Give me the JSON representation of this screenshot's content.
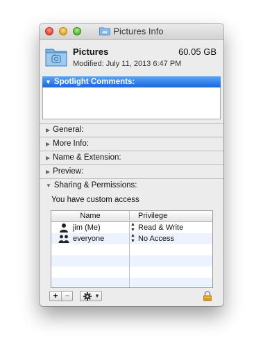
{
  "window": {
    "title": "Pictures Info"
  },
  "header": {
    "name": "Pictures",
    "size": "60.05 GB",
    "modified": "Modified: July 11, 2013 6:47 PM"
  },
  "spotlight": {
    "label": "Spotlight Comments:",
    "value": ""
  },
  "sections": {
    "general": "General:",
    "more_info": "More Info:",
    "name_extension": "Name & Extension:",
    "preview": "Preview:",
    "sharing": "Sharing & Permissions:"
  },
  "permissions": {
    "note": "You have custom access",
    "columns": {
      "name": "Name",
      "privilege": "Privilege"
    },
    "rows": [
      {
        "name": "jim (Me)",
        "privilege": "Read & Write",
        "icon": "user-icon"
      },
      {
        "name": "everyone",
        "privilege": "No Access",
        "icon": "group-icon"
      }
    ]
  },
  "toolbar": {
    "add_label": "+",
    "remove_label": "−",
    "dropdown_arrow": "▼"
  },
  "colors": {
    "selection_blue": "#1a67df",
    "close": "#e0443a",
    "minimize": "#e3a326",
    "maximize": "#56b32e",
    "folder": "#7ab3e0",
    "lock": "#d99a22"
  }
}
